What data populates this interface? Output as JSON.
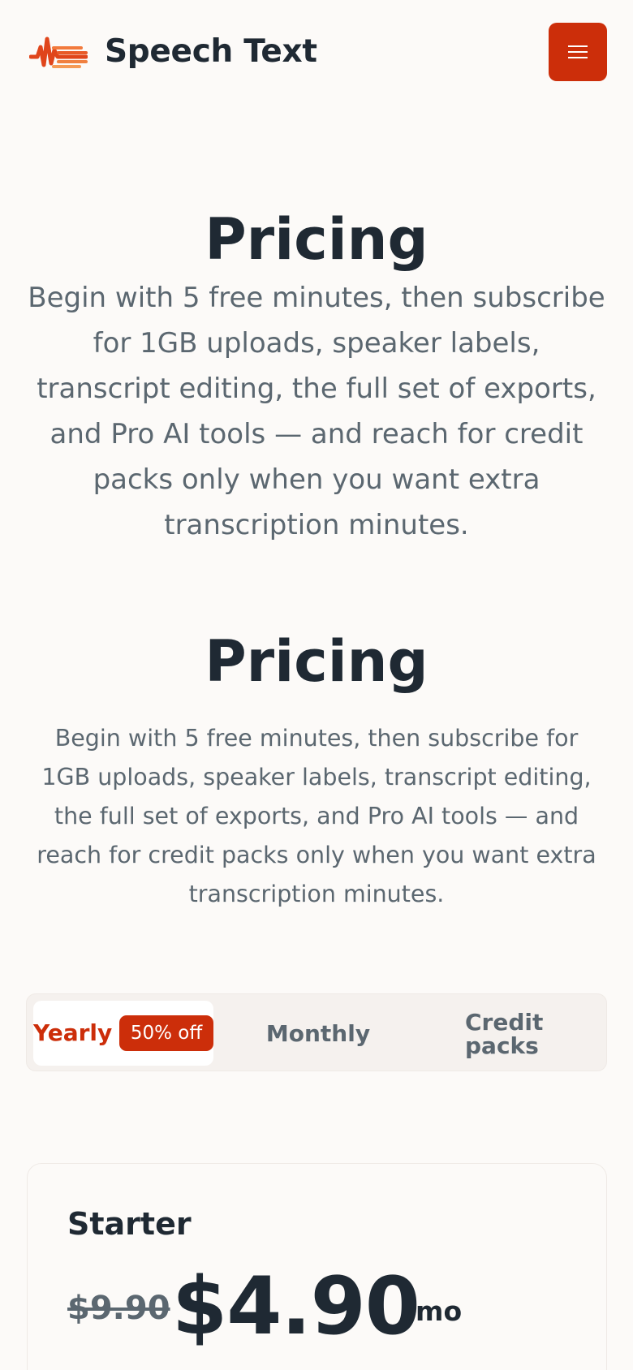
{
  "header": {
    "brand": "Speech Text",
    "logo_icon": "waveform-logo-icon",
    "menu_icon": "hamburger-menu-icon",
    "accent_color": "#cc2e0a"
  },
  "hero_primary": {
    "title": "Pricing",
    "description": "Begin with 5 free minutes, then subscribe for 1GB uploads, speaker labels, transcript editing, the full set of exports, and Pro AI tools — and reach for credit packs only when you want extra transcription minutes."
  },
  "hero_secondary": {
    "title": "Pricing",
    "description": "Begin with 5 free minutes, then subscribe for 1GB uploads, speaker labels, transcript editing, the full set of exports, and Pro AI tools — and reach for credit packs only when you want extra transcription minutes."
  },
  "billing_toggle": {
    "selected": "Yearly",
    "yearly_label": "Yearly",
    "yearly_badge": "50% off",
    "monthly_label": "Monthly",
    "credits_label": "Credit packs"
  },
  "plan": {
    "name": "Starter",
    "old_price": "$9.90",
    "price": "$4.90",
    "period": "/mo"
  }
}
